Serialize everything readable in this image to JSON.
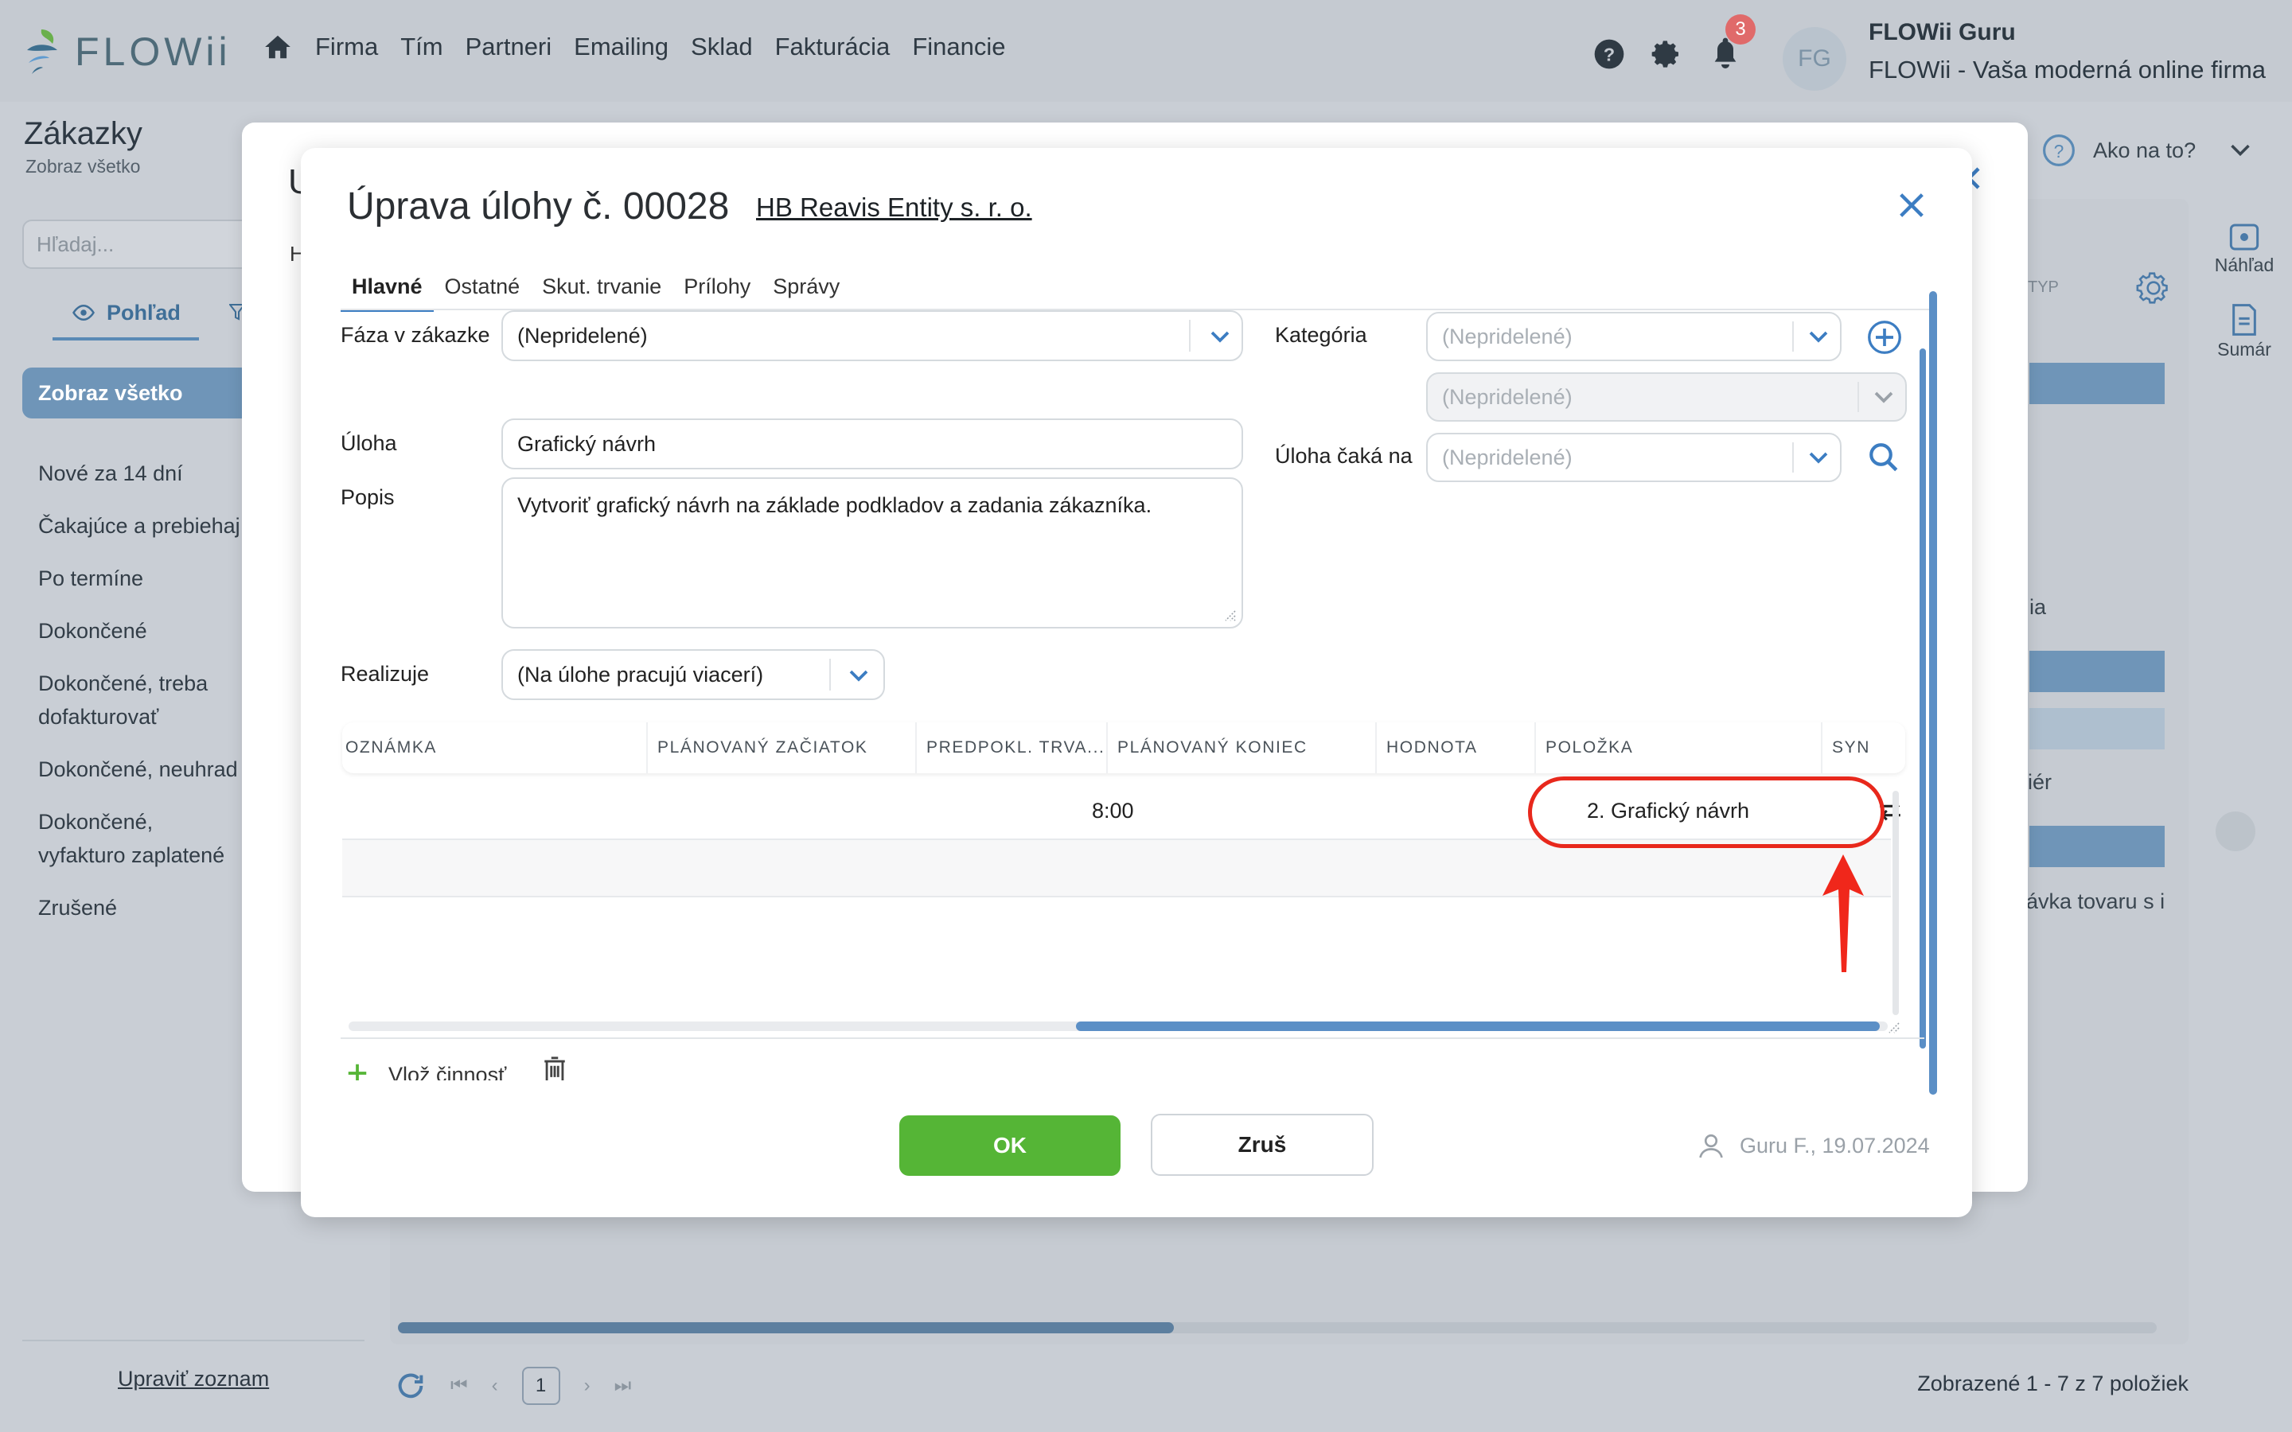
{
  "app": {
    "logo_text": "FLOWii",
    "nav": [
      "Firma",
      "Tím",
      "Partneri",
      "Emailing",
      "Sklad",
      "Fakturácia",
      "Financie"
    ],
    "notifications_count": "3",
    "avatar_initials": "FG",
    "user_name": "FLOWii Guru",
    "user_company": "FLOWii - Vaša moderná online firma"
  },
  "sidebar": {
    "title": "Zákazky",
    "subtitle": "Zobraz všetko",
    "search_placeholder": "Hľadaj...",
    "view_tab": "Pohľad",
    "active_item": "Zobraz všetko",
    "items": [
      "Nové za 14 dní",
      "Čakajúce a prebiehaj",
      "Po termíne",
      "Dokončené",
      "Dokončené, treba dofakturovať",
      "Dokončené, neuhrad",
      "Dokončené, vyfakturo zaplatené",
      "Zrušené"
    ],
    "edit_list": "Upraviť zoznam"
  },
  "background": {
    "help_label": "Ako na to?",
    "preview_label": "Náhľad",
    "summary_label": "Sumár",
    "typ_label": "TYP",
    "frag_1": "ia",
    "frag_2": "iér",
    "frag_3": "ávka tovaru s i",
    "page_number": "1",
    "pager_info": "Zobrazené 1 - 7 z 7 položiek"
  },
  "modal": {
    "title": "Úprava úlohy č. 00028",
    "client_link": "HB Reavis Entity s. r. o.",
    "tabs": [
      "Hlavné",
      "Ostatné",
      "Skut. trvanie",
      "Prílohy",
      "Správy"
    ],
    "active_tab": "Hlavné",
    "fields": {
      "phase_label": "Fáza v zákazke",
      "phase_value": "(Nepridelené)",
      "category_label": "Kategória",
      "category_value": "(Nepridelené)",
      "subcategory_value": "(Nepridelené)",
      "waits_label": "Úloha čaká na",
      "waits_value": "(Nepridelené)",
      "task_label": "Úloha",
      "task_value": "Grafický návrh",
      "desc_label": "Popis",
      "desc_value": "Vytvoriť grafický návrh na základe podkladov a zadania zákazníka.",
      "assignee_label": "Realizuje",
      "assignee_value": "(Na úlohe pracujú viacerí)"
    },
    "grid": {
      "columns": [
        "OZNÁMKA",
        "PLÁNOVANÝ ZAČIATOK",
        "PREDPOKL. TRVA...",
        "PLÁNOVANÝ KONIEC",
        "HODNOTA",
        "POLOŽKA",
        "SYN"
      ],
      "row": {
        "duration": "8:00",
        "item": "2. Grafický návrh"
      }
    },
    "insert_activity": "Vlož činnosť",
    "ok_label": "OK",
    "cancel_label": "Zruš",
    "audit": "Guru F., 19.07.2024"
  },
  "colors": {
    "accent_blue": "#3c7dc2",
    "ok_green": "#55b536",
    "highlight_red": "#e8281c"
  }
}
